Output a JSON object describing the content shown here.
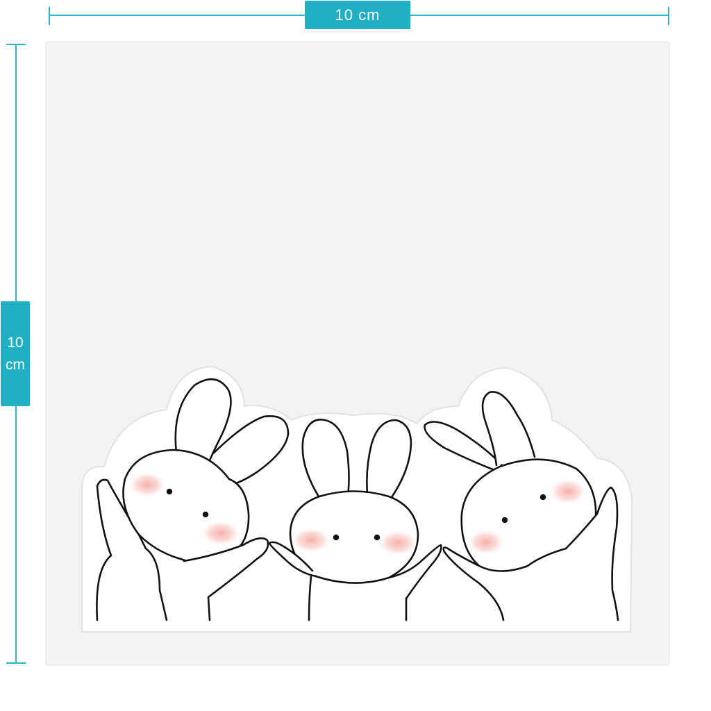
{
  "dimensions": {
    "width_label": "10 cm",
    "height_value": "10",
    "height_unit": "cm"
  },
  "colors": {
    "guide": "#1fb0c6",
    "sheet": "#f3f3f3",
    "outline": "#111111",
    "blush": "#f7b9b4"
  },
  "illustration": {
    "subject_icon": "bunny-icon",
    "count": 3
  }
}
